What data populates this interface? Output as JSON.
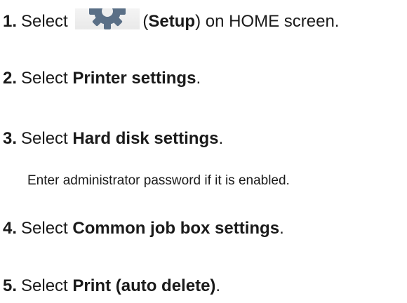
{
  "steps": [
    {
      "number": "1.",
      "pre": "Select",
      "post_open": "(",
      "bold": "Setup",
      "post_close": ") on HOME screen."
    },
    {
      "number": "2.",
      "pre": "Select",
      "bold": "Printer settings",
      "post": "."
    },
    {
      "number": "3.",
      "pre": "Select",
      "bold": "Hard disk settings",
      "post": "."
    },
    {
      "number": "4.",
      "pre": "Select",
      "bold": "Common job box settings",
      "post": "."
    },
    {
      "number": "5.",
      "pre": "Select",
      "bold": "Print (auto delete)",
      "post": "."
    }
  ],
  "note": "Enter administrator password if it is enabled.",
  "icons": {
    "setup": "gear-icon"
  }
}
